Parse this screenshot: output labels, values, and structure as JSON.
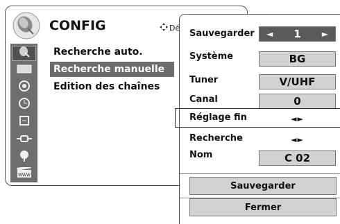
{
  "header": {
    "title": "CONFIG",
    "nav_hint": "Dép"
  },
  "sidebar": {
    "icons": [
      "antenna-icon",
      "screen-icon",
      "speaker-icon",
      "clock-icon",
      "lock-icon",
      "plug-icon",
      "globe-icon",
      "film-icon"
    ],
    "active_index": 0
  },
  "menu": {
    "items": [
      {
        "label": "Recherche auto."
      },
      {
        "label": "Recherche manuelle"
      },
      {
        "label": "Edition des chaînes"
      }
    ],
    "selected_index": 1
  },
  "panel": {
    "sauvegarder": {
      "label": "Sauvegarder",
      "value": "1",
      "left_arrow": "◄",
      "right_arrow": "►"
    },
    "systeme": {
      "label": "Système",
      "value": "BG"
    },
    "tuner": {
      "label": "Tuner",
      "value": "V/UHF"
    },
    "canal": {
      "label": "Canal",
      "value": "0"
    },
    "reglage_fin": {
      "label": "Réglage fin",
      "arrows": "◄►"
    },
    "recherche": {
      "label": "Recherche",
      "arrows": "◄►"
    },
    "nom": {
      "label": "Nom",
      "value": "C 02"
    },
    "save_button": "Sauvegarder",
    "close_button": "Fermer"
  }
}
